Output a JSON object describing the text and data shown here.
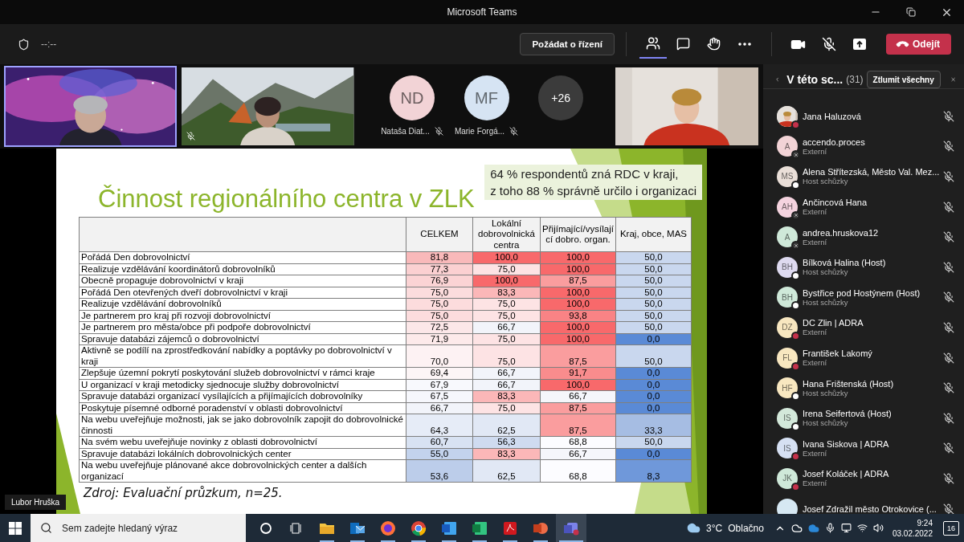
{
  "window": {
    "title": "Microsoft Teams"
  },
  "meeting_bar": {
    "timer": "--:--",
    "request_control": "Požádat o řízení",
    "tabs": [
      {
        "kind": "people",
        "selected": true
      },
      {
        "kind": "chat",
        "selected": false
      },
      {
        "kind": "reactions",
        "selected": false
      }
    ],
    "leave": "Odejít"
  },
  "video_strip": {
    "tiles": [
      {
        "kind": "video",
        "active_speaker": true,
        "muted": false
      },
      {
        "kind": "video",
        "active_speaker": false,
        "muted": true
      },
      {
        "kind": "avatar",
        "initials": "ND",
        "name": "Nataša Diat...",
        "muted": true,
        "color": "#f2d3d6"
      },
      {
        "kind": "avatar",
        "initials": "MF",
        "name": "Marie Forgá...",
        "muted": true,
        "color": "#d6e4f3"
      },
      {
        "kind": "overflow",
        "count": "+26"
      },
      {
        "kind": "video",
        "active_speaker": false,
        "muted": false
      }
    ]
  },
  "presentation": {
    "presenter": "Lubor Hruška",
    "slide": {
      "title": "Činnost regionálního centra v ZLK",
      "callout": [
        "64 % respondentů zná RDC v kraji,",
        "z toho 88 % správně určilo i organizaci"
      ],
      "table": {
        "columns": [
          "CELKEM",
          "Lokální dobrovolnická centra",
          "Přijímající/vysílající dobro. organ.",
          "Kraj, obce, MAS"
        ],
        "rows": [
          {
            "label": "Pořádá Den dobrovolnictví",
            "cells": [
              {
                "value": "81,8",
                "color": "#f9b9ba"
              },
              {
                "value": "100,0",
                "color": "#f8696b"
              },
              {
                "value": "100,0",
                "color": "#f8696b"
              },
              {
                "value": "50,0",
                "color": "#c9d7ee"
              }
            ]
          },
          {
            "label": "Realizuje vzdělávání koordinátorů dobrovolníků",
            "cells": [
              {
                "value": "77,3",
                "color": "#fbd0d1"
              },
              {
                "value": "75,0",
                "color": "#fde3e4"
              },
              {
                "value": "100,0",
                "color": "#f8696b"
              },
              {
                "value": "50,0",
                "color": "#c9d7ee"
              }
            ]
          },
          {
            "label": "Obecně propaguje dobrovolnictví v kraji",
            "cells": [
              {
                "value": "76,9",
                "color": "#fbd3d4"
              },
              {
                "value": "100,0",
                "color": "#f8696b"
              },
              {
                "value": "87,5",
                "color": "#fa9d9e"
              },
              {
                "value": "50,0",
                "color": "#c9d7ee"
              }
            ]
          },
          {
            "label": "Pořádá Den otevřených dveří dobrovolnictví v kraji",
            "cells": [
              {
                "value": "75,0",
                "color": "#fcdcdd"
              },
              {
                "value": "83,3",
                "color": "#fbb7b8"
              },
              {
                "value": "100,0",
                "color": "#f8696b"
              },
              {
                "value": "50,0",
                "color": "#c9d7ee"
              }
            ]
          },
          {
            "label": "Realizuje vzdělávání dobrovolníků",
            "cells": [
              {
                "value": "75,0",
                "color": "#fcdcdd"
              },
              {
                "value": "75,0",
                "color": "#fde3e4"
              },
              {
                "value": "100,0",
                "color": "#f8696b"
              },
              {
                "value": "50,0",
                "color": "#c9d7ee"
              }
            ]
          },
          {
            "label": "Je partnerem pro kraj při rozvoji dobrovolnictví",
            "cells": [
              {
                "value": "75,0",
                "color": "#fcdcdd"
              },
              {
                "value": "75,0",
                "color": "#fde3e4"
              },
              {
                "value": "93,8",
                "color": "#f98385"
              },
              {
                "value": "50,0",
                "color": "#c9d7ee"
              }
            ]
          },
          {
            "label": "Je partnerem pro města/obce při podpoře dobrovolnictví",
            "cells": [
              {
                "value": "72,5",
                "color": "#fce7e8"
              },
              {
                "value": "66,7",
                "color": "#f2f4fa"
              },
              {
                "value": "100,0",
                "color": "#f8696b"
              },
              {
                "value": "50,0",
                "color": "#c9d7ee"
              }
            ]
          },
          {
            "label": "Spravuje databázi zájemců o dobrovolnictví",
            "cells": [
              {
                "value": "71,9",
                "color": "#fdeaea"
              },
              {
                "value": "75,0",
                "color": "#fde3e4"
              },
              {
                "value": "100,0",
                "color": "#f8696b"
              },
              {
                "value": "0,0",
                "color": "#5a8ad6"
              }
            ]
          },
          {
            "label": "Aktivně se podílí na zprostředkování nabídky a poptávky po dobrovolnictví v kraji",
            "cells": [
              {
                "value": "70,0",
                "color": "#fdf2f3"
              },
              {
                "value": "75,0",
                "color": "#fde3e4"
              },
              {
                "value": "87,5",
                "color": "#fa9d9e"
              },
              {
                "value": "50,0",
                "color": "#c9d7ee"
              }
            ]
          },
          {
            "label": "Zlepšuje územní pokrytí poskytování služeb dobrovolnictví v rámci kraje",
            "cells": [
              {
                "value": "69,4",
                "color": "#fcf5f6"
              },
              {
                "value": "66,7",
                "color": "#f2f4fa"
              },
              {
                "value": "91,7",
                "color": "#f98c8d"
              },
              {
                "value": "0,0",
                "color": "#5a8ad6"
              }
            ]
          },
          {
            "label": "U organizací v kraji metodicky sjednocuje služby dobrovolnictví",
            "cells": [
              {
                "value": "67,9",
                "color": "#f8f9fd"
              },
              {
                "value": "66,7",
                "color": "#f2f4fa"
              },
              {
                "value": "100,0",
                "color": "#f8696b"
              },
              {
                "value": "0,0",
                "color": "#5a8ad6"
              }
            ]
          },
          {
            "label": "Spravuje databázi organizací vysílajících a přijímajících dobrovolníky",
            "cells": [
              {
                "value": "67,5",
                "color": "#f6f7fc"
              },
              {
                "value": "83,3",
                "color": "#fbb7b8"
              },
              {
                "value": "66,7",
                "color": "#f5f6fb"
              },
              {
                "value": "0,0",
                "color": "#5a8ad6"
              }
            ]
          },
          {
            "label": "Poskytuje písemné odborné poradenství v oblasti dobrovolnictví",
            "cells": [
              {
                "value": "66,7",
                "color": "#f2f4fa"
              },
              {
                "value": "75,0",
                "color": "#fde3e4"
              },
              {
                "value": "87,5",
                "color": "#fa9d9e"
              },
              {
                "value": "0,0",
                "color": "#5a8ad6"
              }
            ]
          },
          {
            "label": "Na webu uveřejňuje možnosti, jak se jako dobrovolník zapojit do dobrovolnické činnosti",
            "cells": [
              {
                "value": "64,3",
                "color": "#e6ecf7"
              },
              {
                "value": "62,5",
                "color": "#e1e8f5"
              },
              {
                "value": "87,5",
                "color": "#fa9d9e"
              },
              {
                "value": "33,3",
                "color": "#a6bde3"
              }
            ]
          },
          {
            "label": "Na svém webu uveřejňuje novinky z oblasti dobrovolnictví",
            "cells": [
              {
                "value": "60,7",
                "color": "#d8e2f2"
              },
              {
                "value": "56,3",
                "color": "#cfdbf0"
              },
              {
                "value": "68,8",
                "color": "#fcfcff"
              },
              {
                "value": "50,0",
                "color": "#c9d7ee"
              }
            ]
          },
          {
            "label": "Spravuje databázi lokálních dobrovolnických center",
            "cells": [
              {
                "value": "55,0",
                "color": "#c3d3ed"
              },
              {
                "value": "83,3",
                "color": "#fbb7b8"
              },
              {
                "value": "66,7",
                "color": "#f5f6fb"
              },
              {
                "value": "0,0",
                "color": "#5a8ad6"
              }
            ]
          },
          {
            "label": "Na webu uveřejňuje plánované akce dobrovolnických center a dalších organizací",
            "cells": [
              {
                "value": "53,6",
                "color": "#bccdea"
              },
              {
                "value": "62,5",
                "color": "#e1e8f5"
              },
              {
                "value": "68,8",
                "color": "#fcfcff"
              },
              {
                "value": "8,3",
                "color": "#6f98da"
              }
            ]
          }
        ]
      },
      "source": "Zdroj: Evaluační průzkum, n=25."
    }
  },
  "participants_panel": {
    "title": "V této sc...",
    "count": "(31)",
    "mute_all": "Ztlumit všechny",
    "people": [
      {
        "name": "Jana Haluzová",
        "badge": {
          "kind": "busy"
        },
        "muted": true
      },
      {
        "name": "accendo.proces",
        "role": "Externí",
        "kind": "initials",
        "initials": "A",
        "color": "#f2d3d6",
        "badge": {
          "kind": "offline"
        },
        "muted": true
      },
      {
        "name": "Alena Střítezská, Město Val. Mez...",
        "role": "Host schůzky",
        "kind": "initials",
        "initials": "MS",
        "color": "#eadfd8",
        "badge": {
          "kind": "guest"
        },
        "muted": true
      },
      {
        "name": "Ančincová Hana",
        "role": "Externí",
        "kind": "initials",
        "initials": "AH",
        "color": "#f5d3df",
        "badge": {
          "kind": "offline"
        },
        "muted": true
      },
      {
        "name": "andrea.hruskova12",
        "role": "Externí",
        "kind": "initials",
        "initials": "A",
        "color": "#cfe9d9",
        "badge": {
          "kind": "offline"
        },
        "muted": true
      },
      {
        "name": "Bílková Halina (Host)",
        "role": "Host schůzky",
        "kind": "initials",
        "initials": "BH",
        "color": "#dedaf0",
        "badge": {
          "kind": "guest"
        },
        "muted": true
      },
      {
        "name": "Bystřice pod Hostýnem (Host)",
        "role": "Host schůzky",
        "kind": "initials",
        "initials": "BH",
        "color": "#cfe9d9",
        "badge": {
          "kind": "guest"
        },
        "muted": true
      },
      {
        "name": "DC Zlin | ADRA",
        "role": "Externí",
        "kind": "initials",
        "initials": "DZ",
        "color": "#f8e7c0",
        "badge": {
          "kind": "busy"
        },
        "muted": true
      },
      {
        "name": "František Lakomý",
        "role": "Externí",
        "kind": "initials",
        "initials": "FL",
        "color": "#f8e7c0",
        "badge": {
          "kind": "busy"
        },
        "muted": true
      },
      {
        "name": "Hana Frištenská (Host)",
        "role": "Host schůzky",
        "kind": "initials",
        "initials": "HF",
        "color": "#f8e7c0",
        "badge": {
          "kind": "guest"
        },
        "muted": true
      },
      {
        "name": "Irena Seifertová (Host)",
        "role": "Host schůzky",
        "kind": "initials",
        "initials": "IS",
        "color": "#d3e8da",
        "badge": {
          "kind": "guest"
        },
        "muted": true
      },
      {
        "name": "Ivana Siskova | ADRA",
        "role": "Externí",
        "kind": "initials",
        "initials": "IS",
        "color": "#d6e0f3",
        "badge": {
          "kind": "busy"
        },
        "muted": true
      },
      {
        "name": "Josef Koláček | ADRA",
        "role": "Externí",
        "kind": "initials",
        "initials": "JK",
        "color": "#cfe9d9",
        "badge": {
          "kind": "busy"
        },
        "muted": true
      },
      {
        "name": "Josef Zdražil město Otrokovice (...",
        "kind": "initials",
        "color": "#d6e8f3",
        "muted": true
      }
    ]
  },
  "taskbar": {
    "search": {
      "placeholder": "Sem zadejte hledaný výraz"
    },
    "apps": [
      {
        "kind": "folder",
        "running": true,
        "selected": false
      },
      {
        "kind": "mail",
        "running": true,
        "selected": false
      },
      {
        "kind": "browser",
        "running": true,
        "selected": false
      },
      {
        "kind": "globe",
        "running": true,
        "selected": false
      },
      {
        "kind": "document",
        "running": true,
        "selected": false
      },
      {
        "kind": "spreadsheet",
        "running": true,
        "selected": false
      },
      {
        "kind": "pdf",
        "running": true,
        "selected": false
      },
      {
        "kind": "slides",
        "running": true,
        "selected": false
      },
      {
        "kind": "teams",
        "running": true,
        "selected": true
      }
    ],
    "temperature": "3°C",
    "weather": "Oblačno",
    "time": "9:24",
    "date": "03.02.2022",
    "notifications": "16"
  }
}
